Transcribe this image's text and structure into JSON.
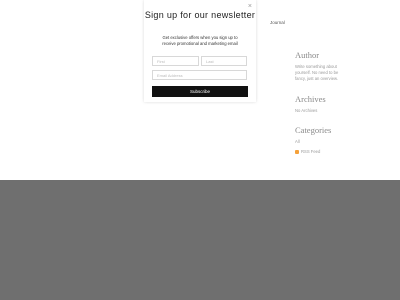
{
  "nav": {
    "journal_label": "Journal"
  },
  "sidebar": {
    "author": {
      "title": "Author",
      "text": "Write something about yourself. No need to be fancy, just an overview."
    },
    "archives": {
      "title": "Archives",
      "text": "No Archives"
    },
    "categories": {
      "title": "Categories",
      "items": [
        "All"
      ],
      "rss_label": "RSS Feed"
    }
  },
  "popup": {
    "close_symbol": "×",
    "title": "Sign up for our newsletter",
    "description": "Get exclusive offers when you sign up to receive promotional and marketing email",
    "first_placeholder": "First",
    "last_placeholder": "Last",
    "email_placeholder": "Email Address",
    "subscribe_label": "Subscribe"
  },
  "colors": {
    "footer_band": "#6f6f6f",
    "button": "#111111",
    "rss": "#f5a13a"
  }
}
